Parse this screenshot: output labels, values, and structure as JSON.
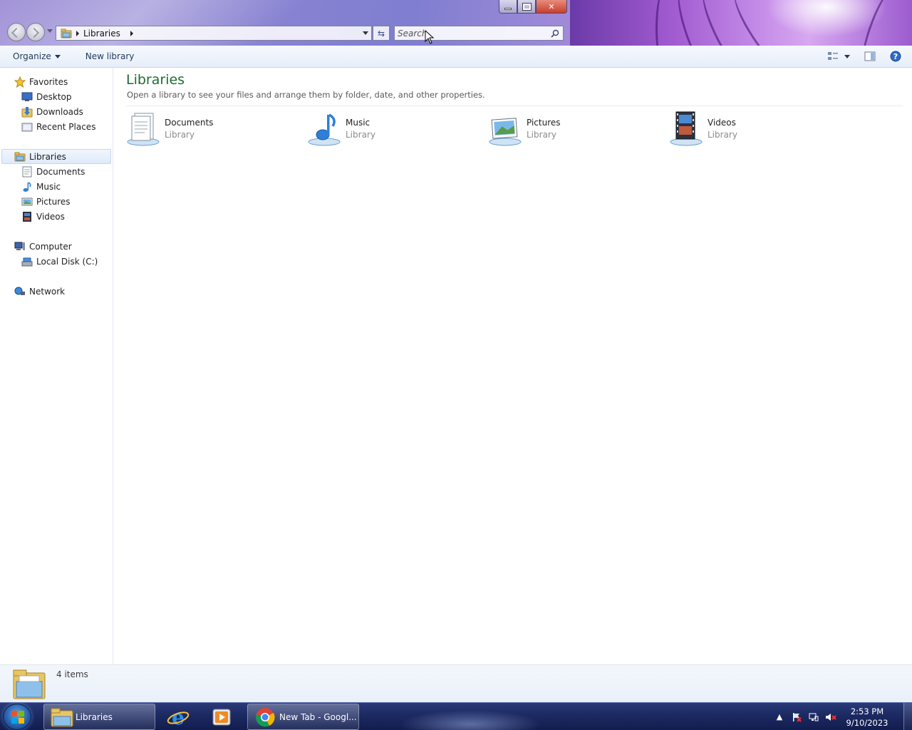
{
  "window": {
    "address": {
      "crumbs": [
        "Libraries"
      ]
    },
    "search": {
      "placeholder": "Search"
    }
  },
  "toolbar": {
    "organize_label": "Organize",
    "new_library_label": "New library"
  },
  "nav": {
    "favorites": {
      "label": "Favorites",
      "icon": "star-icon",
      "items": [
        {
          "label": "Desktop",
          "icon": "desktop-icon"
        },
        {
          "label": "Downloads",
          "icon": "downloads-folder-icon"
        },
        {
          "label": "Recent Places",
          "icon": "recent-places-icon"
        }
      ]
    },
    "libraries": {
      "label": "Libraries",
      "icon": "libraries-icon",
      "items": [
        {
          "label": "Documents",
          "icon": "documents-icon"
        },
        {
          "label": "Music",
          "icon": "music-note-icon"
        },
        {
          "label": "Pictures",
          "icon": "pictures-icon"
        },
        {
          "label": "Videos",
          "icon": "videos-icon"
        }
      ]
    },
    "computer": {
      "label": "Computer",
      "icon": "computer-icon",
      "items": [
        {
          "label": "Local Disk (C:)",
          "icon": "hard-drive-icon"
        }
      ]
    },
    "network": {
      "label": "Network",
      "icon": "network-icon"
    }
  },
  "content": {
    "title": "Libraries",
    "subtitle": "Open a library to see your files and arrange them by folder, date, and other properties.",
    "libraries": [
      {
        "name": "Documents",
        "kind": "Library"
      },
      {
        "name": "Music",
        "kind": "Library"
      },
      {
        "name": "Pictures",
        "kind": "Library"
      },
      {
        "name": "Videos",
        "kind": "Library"
      }
    ]
  },
  "details": {
    "count": "4 items"
  },
  "taskbar": {
    "explorer_label": "Libraries",
    "chrome_label": "New Tab - Googl...",
    "time": "2:53 PM",
    "date": "9/10/2023"
  },
  "colors": {
    "title_green": "#1e6c32",
    "selection_blue": "#dfeafb",
    "taskbar_navy": "#1c2a62"
  }
}
